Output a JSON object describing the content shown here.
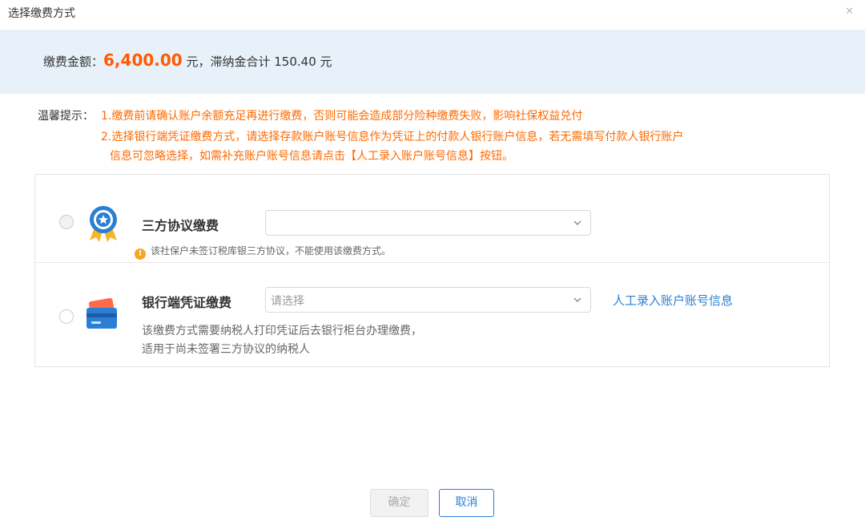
{
  "dialog": {
    "title": "选择缴费方式",
    "close_glyph": "✕"
  },
  "summary": {
    "label": "缴费金额：",
    "amount": "6,400.00",
    "rest": " 元，滞纳金合计 150.40 元"
  },
  "notice": {
    "label": "温馨提示：",
    "lines": [
      "1.缴费前请确认账户余额充足再进行缴费，否则可能会造成部分险种缴费失败，影响社保权益兑付",
      "2.选择银行端凭证缴费方式，请选择存款账户账号信息作为凭证上的付款人银行账户信息，若无需填写付款人银行账户",
      "信息可忽略选择，如需补充账户账号信息请点击【人工录入账户账号信息】按钮。"
    ]
  },
  "options": [
    {
      "title": "三方协议缴费",
      "select_placeholder": "",
      "warning": "该社保户未签订税库银三方协议，不能使用该缴费方式。",
      "icon": "medal-icon"
    },
    {
      "title": "银行端凭证缴费",
      "select_placeholder": "请选择",
      "desc_lines": [
        "该缴费方式需要纳税人打印凭证后去银行柜台办理缴费，",
        "适用于尚未签署三方协议的纳税人"
      ],
      "link": "人工录入账户账号信息",
      "icon": "bank-card-icon"
    }
  ],
  "buttons": {
    "confirm": "确定",
    "cancel": "取消"
  },
  "colors": {
    "accent": "#2a7fd4",
    "amount": "#ff5a00",
    "notice": "#ff6a00",
    "band": "#e8f1fa"
  }
}
